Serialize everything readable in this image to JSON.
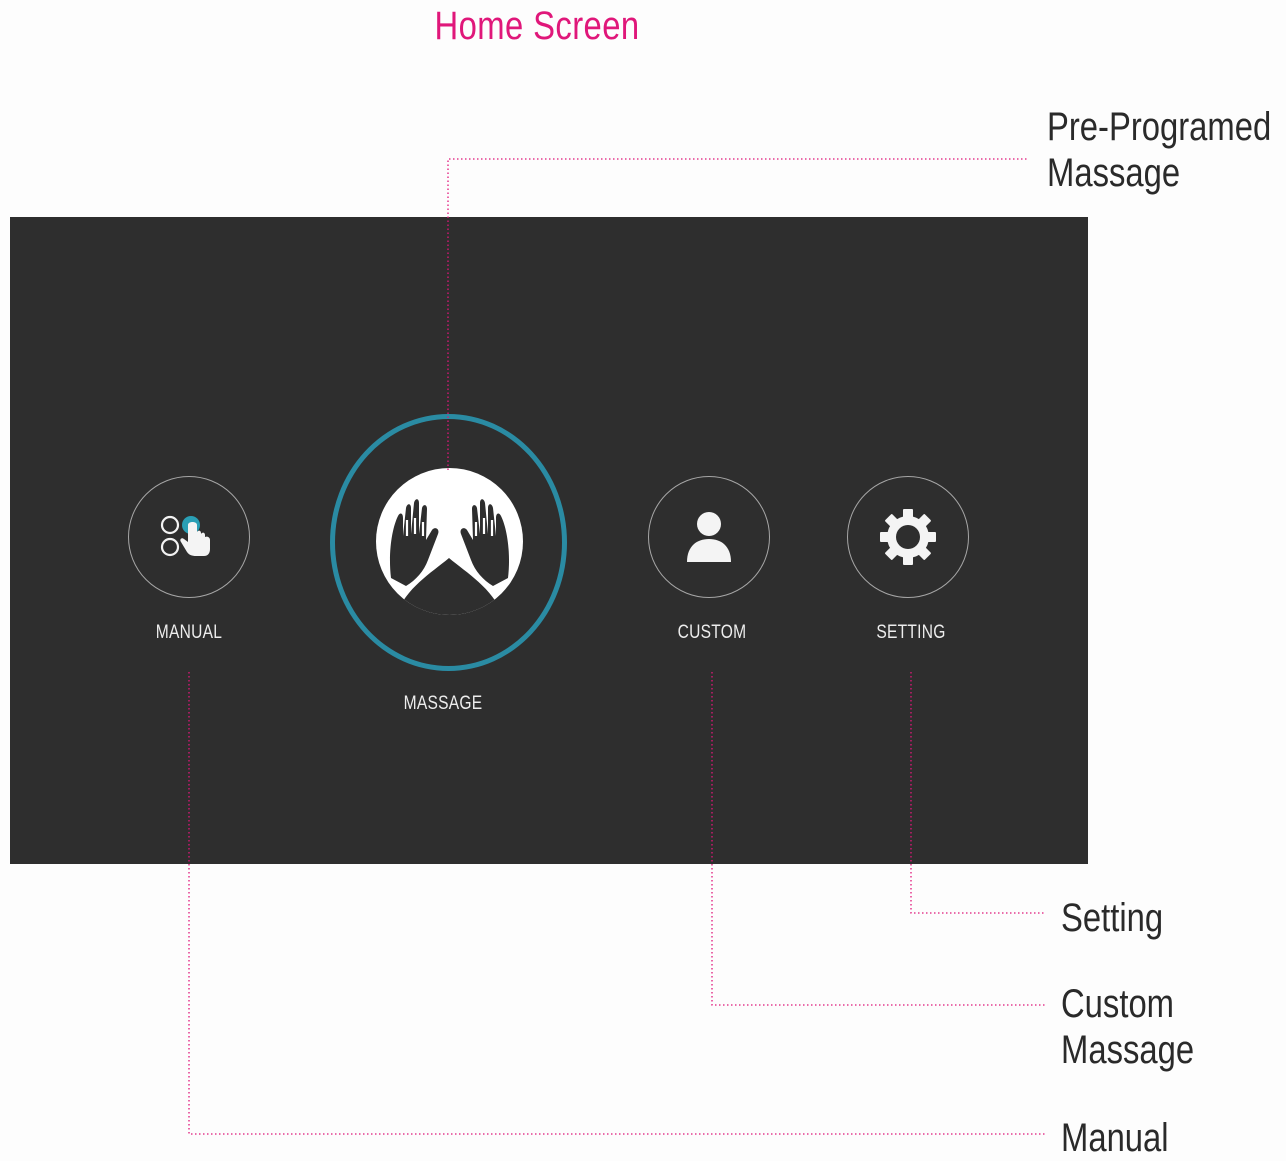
{
  "page_title": "Home Screen",
  "accent_color": "#e0177a",
  "ring_color": "#2a8ba3",
  "screen": {
    "buttons": [
      {
        "id": "manual",
        "label": "MANUAL",
        "icon": "manual-touch-icon"
      },
      {
        "id": "massage",
        "label": "MASSAGE",
        "icon": "hands-icon",
        "selected": true
      },
      {
        "id": "custom",
        "label": "CUSTOM",
        "icon": "user-icon"
      },
      {
        "id": "setting",
        "label": "SETTING",
        "icon": "gear-icon"
      }
    ]
  },
  "callouts": {
    "pre_programed": [
      "Pre-Programed",
      "Massage"
    ],
    "setting": [
      "Setting"
    ],
    "custom": [
      "Custom",
      "Massage"
    ],
    "manual": [
      "Manual"
    ]
  }
}
